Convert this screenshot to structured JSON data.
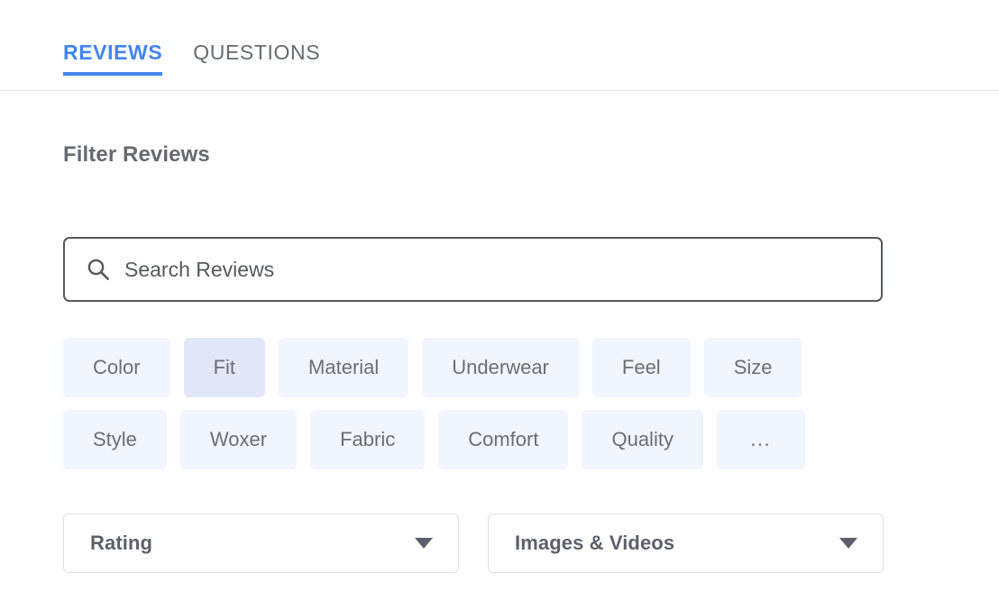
{
  "tabs": [
    {
      "label": "REVIEWS",
      "active": true
    },
    {
      "label": "QUESTIONS",
      "active": false
    }
  ],
  "section": {
    "title": "Filter Reviews"
  },
  "search": {
    "placeholder": "Search Reviews",
    "value": "",
    "icon": "search-icon"
  },
  "chips": {
    "row1": [
      {
        "label": "Color",
        "selected": false
      },
      {
        "label": "Fit",
        "selected": true
      },
      {
        "label": "Material",
        "selected": false
      },
      {
        "label": "Underwear",
        "selected": false
      },
      {
        "label": "Feel",
        "selected": false
      },
      {
        "label": "Size",
        "selected": false
      }
    ],
    "row2": [
      {
        "label": "Style",
        "selected": false
      },
      {
        "label": "Woxer",
        "selected": false
      },
      {
        "label": "Fabric",
        "selected": false
      },
      {
        "label": "Comfort",
        "selected": false
      },
      {
        "label": "Quality",
        "selected": false
      },
      {
        "label": "…",
        "selected": false,
        "more": true
      }
    ]
  },
  "dropdowns": [
    {
      "label": "Rating",
      "icon": "chevron-down-icon"
    },
    {
      "label": "Images & Videos",
      "icon": "chevron-down-icon"
    }
  ],
  "colors": {
    "accent": "#4285f0",
    "chip_bg": "#f1f5fd",
    "chip_selected_bg": "#e1e7f8",
    "text_muted": "#676a70",
    "border": "#dfe0e2",
    "search_border": "#57585c"
  }
}
